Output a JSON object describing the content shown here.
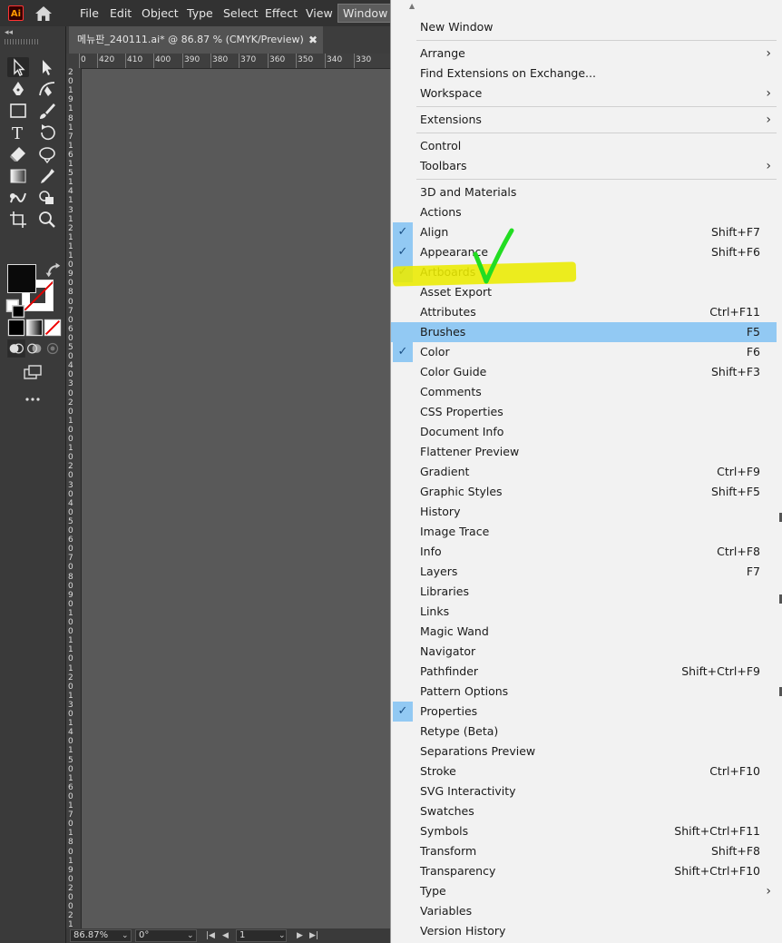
{
  "app": {
    "logo_text": "Ai",
    "menus": [
      "File",
      "Edit",
      "Object",
      "Type",
      "Select",
      "Effect",
      "View",
      "Window"
    ],
    "active_menu": "Window"
  },
  "document": {
    "tab_title": "메뉴판_240111.ai* @ 86.87 % (CMYK/Preview)",
    "close_glyph": "✖"
  },
  "ruler": {
    "top_labels": [
      "0",
      "420",
      "410",
      "400",
      "390",
      "380",
      "370",
      "360",
      "350",
      "340",
      "330"
    ],
    "left_digits": [
      "2",
      "0",
      "1",
      "9",
      "1",
      "8",
      "1",
      "7",
      "1",
      "6",
      "1",
      "5",
      "1",
      "4",
      "1",
      "3",
      "1",
      "2",
      "1",
      "1",
      "1",
      "0",
      "9",
      "0",
      "8",
      "0",
      "7",
      "0",
      "6",
      "0",
      "5",
      "0",
      "4",
      "0",
      "3",
      "0",
      "2",
      "0",
      "1",
      "0",
      "0",
      "1",
      "0",
      "2",
      "0",
      "3",
      "0",
      "4",
      "0",
      "5",
      "0",
      "6",
      "0",
      "7",
      "0",
      "8",
      "0",
      "9",
      "0",
      "1",
      "0",
      "0",
      "1",
      "1",
      "0",
      "1",
      "2",
      "0",
      "1",
      "3",
      "0",
      "1",
      "4",
      "0",
      "1",
      "5",
      "0",
      "1",
      "6",
      "0",
      "1",
      "7",
      "0",
      "1",
      "8",
      "0",
      "1",
      "9",
      "0",
      "2",
      "0",
      "0",
      "2",
      "1",
      "0"
    ]
  },
  "status": {
    "zoom": "86.87%",
    "rotation": "0°",
    "artboard": "1"
  },
  "window_menu": {
    "items": [
      {
        "label": "New Window",
        "checked": false,
        "shortcut": "",
        "submenu": false
      },
      {
        "sep": true
      },
      {
        "label": "Arrange",
        "checked": false,
        "shortcut": "",
        "submenu": true
      },
      {
        "label": "Find Extensions on Exchange...",
        "checked": false,
        "shortcut": "",
        "submenu": false
      },
      {
        "label": "Workspace",
        "checked": false,
        "shortcut": "",
        "submenu": true
      },
      {
        "sep": true
      },
      {
        "label": "Extensions",
        "checked": false,
        "shortcut": "",
        "submenu": true
      },
      {
        "sep": true
      },
      {
        "label": "Control",
        "checked": false,
        "shortcut": "",
        "submenu": false
      },
      {
        "label": "Toolbars",
        "checked": false,
        "shortcut": "",
        "submenu": true
      },
      {
        "sep": true
      },
      {
        "label": "3D and Materials",
        "checked": false,
        "shortcut": "",
        "submenu": false
      },
      {
        "label": "Actions",
        "checked": false,
        "shortcut": "",
        "submenu": false
      },
      {
        "label": "Align",
        "checked": true,
        "shortcut": "Shift+F7",
        "submenu": false
      },
      {
        "label": "Appearance",
        "checked": true,
        "shortcut": "Shift+F6",
        "submenu": false
      },
      {
        "label": "Artboards",
        "checked": true,
        "shortcut": "",
        "submenu": false
      },
      {
        "label": "Asset Export",
        "checked": false,
        "shortcut": "",
        "submenu": false
      },
      {
        "label": "Attributes",
        "checked": false,
        "shortcut": "Ctrl+F11",
        "submenu": false
      },
      {
        "label": "Brushes",
        "checked": false,
        "shortcut": "F5",
        "submenu": false,
        "highlighted": true
      },
      {
        "label": "Color",
        "checked": true,
        "shortcut": "F6",
        "submenu": false
      },
      {
        "label": "Color Guide",
        "checked": false,
        "shortcut": "Shift+F3",
        "submenu": false
      },
      {
        "label": "Comments",
        "checked": false,
        "shortcut": "",
        "submenu": false
      },
      {
        "label": "CSS Properties",
        "checked": false,
        "shortcut": "",
        "submenu": false
      },
      {
        "label": "Document Info",
        "checked": false,
        "shortcut": "",
        "submenu": false
      },
      {
        "label": "Flattener Preview",
        "checked": false,
        "shortcut": "",
        "submenu": false
      },
      {
        "label": "Gradient",
        "checked": false,
        "shortcut": "Ctrl+F9",
        "submenu": false
      },
      {
        "label": "Graphic Styles",
        "checked": false,
        "shortcut": "Shift+F5",
        "submenu": false
      },
      {
        "label": "History",
        "checked": false,
        "shortcut": "",
        "submenu": false
      },
      {
        "label": "Image Trace",
        "checked": false,
        "shortcut": "",
        "submenu": false
      },
      {
        "label": "Info",
        "checked": false,
        "shortcut": "Ctrl+F8",
        "submenu": false
      },
      {
        "label": "Layers",
        "checked": false,
        "shortcut": "F7",
        "submenu": false
      },
      {
        "label": "Libraries",
        "checked": false,
        "shortcut": "",
        "submenu": false
      },
      {
        "label": "Links",
        "checked": false,
        "shortcut": "",
        "submenu": false
      },
      {
        "label": "Magic Wand",
        "checked": false,
        "shortcut": "",
        "submenu": false
      },
      {
        "label": "Navigator",
        "checked": false,
        "shortcut": "",
        "submenu": false
      },
      {
        "label": "Pathfinder",
        "checked": false,
        "shortcut": "Shift+Ctrl+F9",
        "submenu": false
      },
      {
        "label": "Pattern Options",
        "checked": false,
        "shortcut": "",
        "submenu": false
      },
      {
        "label": "Properties",
        "checked": true,
        "shortcut": "",
        "submenu": false
      },
      {
        "label": "Retype (Beta)",
        "checked": false,
        "shortcut": "",
        "submenu": false
      },
      {
        "label": "Separations Preview",
        "checked": false,
        "shortcut": "",
        "submenu": false
      },
      {
        "label": "Stroke",
        "checked": false,
        "shortcut": "Ctrl+F10",
        "submenu": false
      },
      {
        "label": "SVG Interactivity",
        "checked": false,
        "shortcut": "",
        "submenu": false
      },
      {
        "label": "Swatches",
        "checked": false,
        "shortcut": "",
        "submenu": false
      },
      {
        "label": "Symbols",
        "checked": false,
        "shortcut": "Shift+Ctrl+F11",
        "submenu": false
      },
      {
        "label": "Transform",
        "checked": false,
        "shortcut": "Shift+F8",
        "submenu": false
      },
      {
        "label": "Transparency",
        "checked": false,
        "shortcut": "Shift+Ctrl+F10",
        "submenu": false
      },
      {
        "label": "Type",
        "checked": false,
        "shortcut": "",
        "submenu": true
      },
      {
        "label": "Variables",
        "checked": false,
        "shortcut": "",
        "submenu": false
      },
      {
        "label": "Version History",
        "checked": false,
        "shortcut": "",
        "submenu": false
      }
    ]
  },
  "annotation": {
    "highlighter_color": "#eaea00",
    "checkmark_color": "#22dd22"
  },
  "colors": {
    "menu_highlight": "#92c9f3",
    "app_chrome": "#323232",
    "canvas": "#595959"
  }
}
